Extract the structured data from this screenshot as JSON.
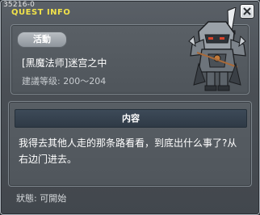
{
  "window": {
    "quest_id": "35216-0",
    "title": "QUEST INFO"
  },
  "quest": {
    "category_badge": "活動",
    "name": "[黑魔法师]迷宫之中",
    "level_requirement": "建議等级: 200～204"
  },
  "content": {
    "header": "内容",
    "text": "我得去其他人走的那条路看看，到底出什么事了?从右边门进去。"
  },
  "status": {
    "text": "狀態:  可開始"
  },
  "icons": {
    "close": "close-icon",
    "portrait": "armored-knight-portrait"
  },
  "colors": {
    "title": "#f1e24a",
    "content_header": "#35414e"
  }
}
